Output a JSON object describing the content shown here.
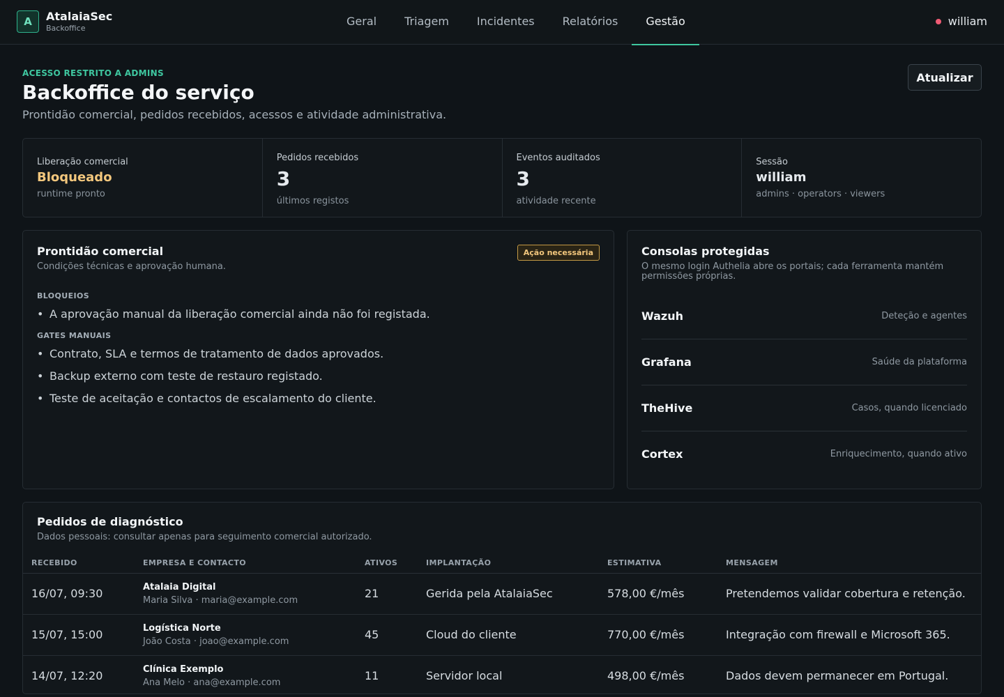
{
  "brand": {
    "mark": "A",
    "name": "AtalaiaSec",
    "sub": "Backoffice"
  },
  "nav": {
    "tabs": [
      "Geral",
      "Triagem",
      "Incidentes",
      "Relatórios",
      "Gestão"
    ],
    "active": "Gestão"
  },
  "user": {
    "name": "william",
    "status_color": "#ef5b74"
  },
  "header": {
    "eyebrow": "ACESSO RESTRITO A ADMINS",
    "title": "Backoffice do serviço",
    "subtitle": "Prontidão comercial, pedidos recebidos, acessos e atividade administrativa.",
    "refresh_label": "Atualizar"
  },
  "stats": [
    {
      "label": "Liberação comercial",
      "value": "Bloqueado",
      "note": "runtime pronto",
      "color": "#f3c77d"
    },
    {
      "label": "Pedidos recebidos",
      "value": "3",
      "note": "últimos registos"
    },
    {
      "label": "Eventos auditados",
      "value": "3",
      "note": "atividade recente"
    },
    {
      "label": "Sessão",
      "value": "william",
      "note": "admins · operators · viewers"
    }
  ],
  "readiness": {
    "title": "Prontidão comercial",
    "subtitle": "Condições técnicas e aprovação humana.",
    "badge": "Ação necessária",
    "blockers_label": "BLOQUEIOS",
    "blockers": [
      "A aprovação manual da liberação comercial ainda não foi registada."
    ],
    "gates_label": "GATES MANUAIS",
    "gates": [
      "Contrato, SLA e termos de tratamento de dados aprovados.",
      "Backup externo com teste de restauro registado.",
      "Teste de aceitação e contactos de escalamento do cliente."
    ]
  },
  "consoles": {
    "title": "Consolas protegidas",
    "subtitle": "O mesmo login Authelia abre os portais; cada ferramenta mantém permissões próprias.",
    "items": [
      {
        "name": "Wazuh",
        "desc": "Deteção e agentes"
      },
      {
        "name": "Grafana",
        "desc": "Saúde da plataforma"
      },
      {
        "name": "TheHive",
        "desc": "Casos, quando licenciado"
      },
      {
        "name": "Cortex",
        "desc": "Enriquecimento, quando ativo"
      }
    ]
  },
  "requests": {
    "title": "Pedidos de diagnóstico",
    "subtitle": "Dados pessoais: consultar apenas para seguimento comercial autorizado.",
    "columns": [
      "RECEBIDO",
      "EMPRESA E CONTACTO",
      "ATIVOS",
      "IMPLANTAÇÃO",
      "ESTIMATIVA",
      "MENSAGEM"
    ],
    "rows": [
      {
        "received": "16/07, 09:30",
        "company": "Atalaia Digital",
        "contact": "Maria Silva · maria@example.com",
        "assets": "21",
        "deployment": "Gerida pela AtalaiaSec",
        "estimate": "578,00 €/mês",
        "message": "Pretendemos validar cobertura e retenção."
      },
      {
        "received": "15/07, 15:00",
        "company": "Logística Norte",
        "contact": "João Costa · joao@example.com",
        "assets": "45",
        "deployment": "Cloud do cliente",
        "estimate": "770,00 €/mês",
        "message": "Integração com firewall e Microsoft 365."
      },
      {
        "received": "14/07, 12:20",
        "company": "Clínica Exemplo",
        "contact": "Ana Melo · ana@example.com",
        "assets": "11",
        "deployment": "Servidor local",
        "estimate": "498,00 €/mês",
        "message": "Dados devem permanecer em Portugal."
      }
    ]
  }
}
